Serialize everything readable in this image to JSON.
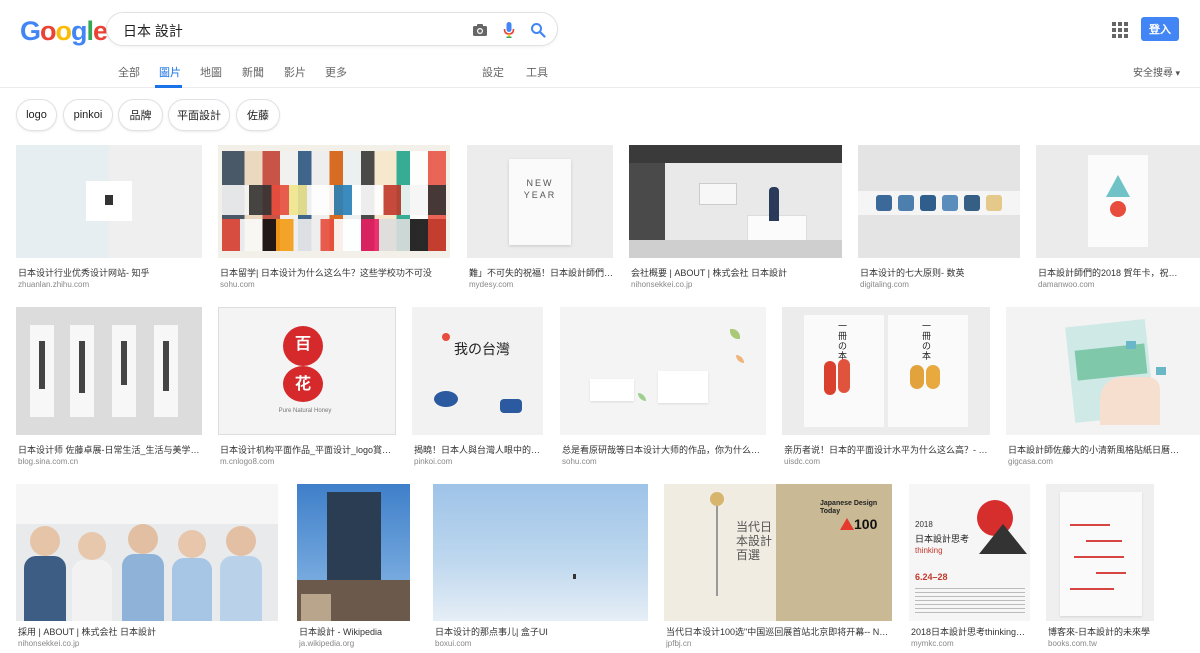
{
  "logo": {
    "text": "Google"
  },
  "search": {
    "query": "日本 設計"
  },
  "header": {
    "signin_label": "登入"
  },
  "tabs": [
    {
      "label": "全部"
    },
    {
      "label": "圖片"
    },
    {
      "label": "地圖"
    },
    {
      "label": "新聞"
    },
    {
      "label": "影片"
    },
    {
      "label": "更多"
    },
    {
      "label": "設定"
    },
    {
      "label": "工具"
    }
  ],
  "safe_search": "安全搜尋",
  "chips": [
    {
      "label": "logo"
    },
    {
      "label": "pinkoi"
    },
    {
      "label": "品牌"
    },
    {
      "label": "平面設計"
    },
    {
      "label": "佐藤"
    }
  ],
  "results": [
    {
      "caption": "日本设计行业优秀设计网站- 知乎",
      "domain": "zhuanlan.zhihu.com"
    },
    {
      "caption": "日本留学| 日本设计为什么这么牛？这些学校功不可没",
      "domain": "sohu.com"
    },
    {
      "caption": "難」不可失的祝福！日本設計師們…",
      "domain": "mydesy.com"
    },
    {
      "caption": "会社概要 | ABOUT | 株式会社 日本設計",
      "domain": "nihonsekkei.co.jp"
    },
    {
      "caption": "日本设计的七大原则- 数英",
      "domain": "digitaling.com"
    },
    {
      "caption": "日本設計師們的2018 賀年卡，祝…",
      "domain": "damanwoo.com"
    },
    {
      "caption": "日本设计师 佐藤卓展-日常生活_生活与美学…",
      "domain": "blog.sina.com.cn"
    },
    {
      "caption": "日本设计机构平面作品_平面设计_logo賞…",
      "domain": "m.cnlogo8.com"
    },
    {
      "caption": "揭曉！日本人與台灣人眼中的…",
      "domain": "pinkoi.com"
    },
    {
      "caption": "总是看原研哉等日本设计大师的作品，你为什么…",
      "domain": "sohu.com"
    },
    {
      "caption": "亲历者说！日本的平面设计水平为什么这么高？- …",
      "domain": "uisdc.com"
    },
    {
      "caption": "日本設計師佐藤大的小清新風格貼紙日曆…",
      "domain": "gigcasa.com"
    },
    {
      "caption": "採用 | ABOUT | 株式会社 日本設計",
      "domain": "nihonsekkei.co.jp"
    },
    {
      "caption": "日本設計 - Wikipedia",
      "domain": "ja.wikipedia.org"
    },
    {
      "caption": "日本设计的那点事儿| 盒子UI",
      "domain": "boxui.com"
    },
    {
      "caption": "当代日本设计100选\"中国巡回展首站北京即将开幕-- NE…",
      "domain": "jpfbj.cn"
    },
    {
      "caption": "2018日本設計思考thinking…",
      "domain": "mymkc.com"
    },
    {
      "caption": "博客來-日本設計的未來學",
      "domain": "books.com.tw"
    }
  ],
  "thumb_texts": {
    "newyear": "NEW YEAR",
    "hyakka_a": "百",
    "hyakka_b": "花",
    "hyakka_sub": "Pure Natural Honey",
    "taiwan": "我の台灣",
    "hon_left": "一冊の本",
    "hon_right": "一冊の本",
    "design100_title": "Japanese Design Today",
    "design100_num": "100",
    "design100_kanji": "当代日本設計百選",
    "thinking_year": "2018",
    "thinking_title": "日本設計思考",
    "thinking_en": "thinking",
    "thinking_dates": "6.24–28"
  }
}
